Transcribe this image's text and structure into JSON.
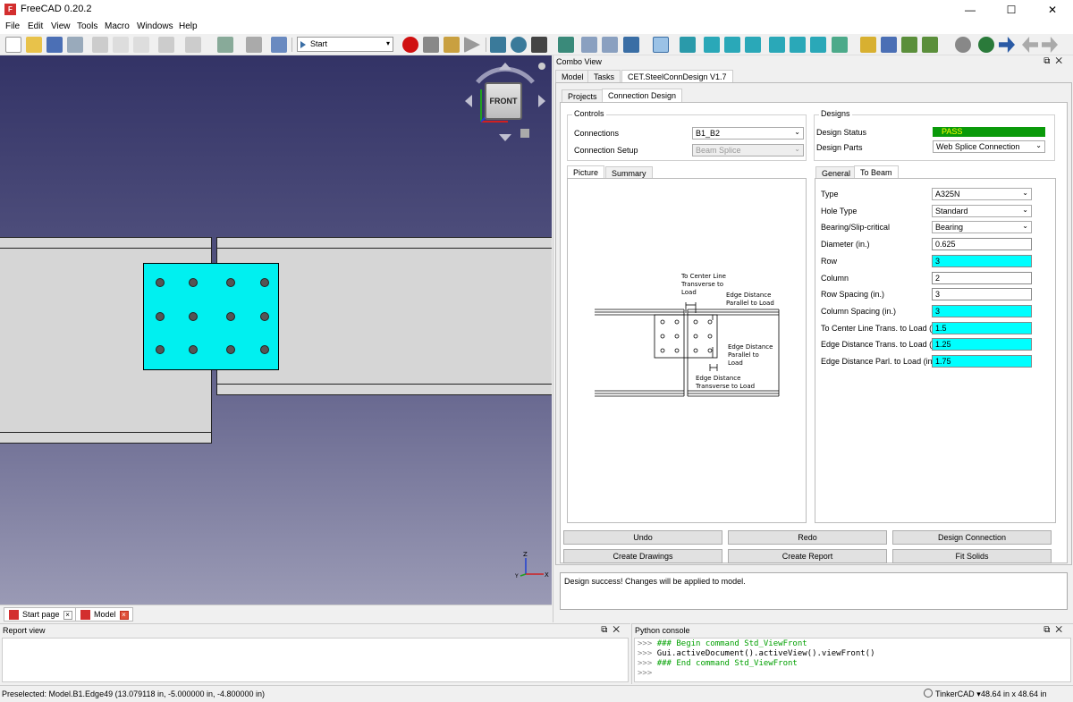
{
  "window": {
    "title": "FreeCAD 0.20.2",
    "minimize": "—",
    "maximize": "☐",
    "close": "✕"
  },
  "menu": [
    "File",
    "Edit",
    "View",
    "Tools",
    "Macro",
    "Windows",
    "Help"
  ],
  "toolbar": {
    "workbench": "Start"
  },
  "view3d": {
    "navcube_face": "FRONT",
    "axis_z": "Z",
    "axis_x": "X",
    "axis_y": "Y"
  },
  "view_tabs": [
    {
      "label": "Start page"
    },
    {
      "label": "Model"
    }
  ],
  "combo": {
    "title": "Combo View",
    "tabs": [
      "Model",
      "Tasks",
      "CET.SteelConnDesign V1.7"
    ],
    "subtabs": [
      "Projects",
      "Connection Design"
    ],
    "controls": {
      "title": "Controls",
      "connections_label": "Connections",
      "connections_value": "B1_B2",
      "setup_label": "Connection Setup",
      "setup_value": "Beam Splice"
    },
    "designs": {
      "title": "Designs",
      "status_label": "Design Status",
      "status_value": "PASS",
      "parts_label": "Design Parts",
      "parts_value": "Web Splice Connection"
    },
    "picture_tabs": [
      "Picture",
      "Summary"
    ],
    "diagram": {
      "l1": "To Center Line",
      "l2": "Transverse to",
      "l3": "Load",
      "e1": "Edge Distance",
      "e2": "Parallel to Load",
      "p1": "Edge Distance",
      "p2": "Parallel to",
      "p3": "Load",
      "t1": "Edge Distance",
      "t2": "Transverse to Load"
    },
    "param_tabs": [
      "General",
      "To Beam"
    ],
    "params": [
      {
        "label": "Type",
        "value": "A325N",
        "kind": "combo"
      },
      {
        "label": "Hole Type",
        "value": "Standard",
        "kind": "combo"
      },
      {
        "label": "Bearing/Slip-critical",
        "value": "Bearing",
        "kind": "combo"
      },
      {
        "label": "Diameter (in.)",
        "value": "0.625",
        "kind": "field"
      },
      {
        "label": "Row",
        "value": "3",
        "kind": "cyan"
      },
      {
        "label": "Column",
        "value": "2",
        "kind": "field"
      },
      {
        "label": "Row Spacing (in.)",
        "value": "3",
        "kind": "field"
      },
      {
        "label": "Column Spacing (in.)",
        "value": "3",
        "kind": "cyan"
      },
      {
        "label": "To Center Line Trans. to Load (in.)",
        "value": "1.5",
        "kind": "cyan"
      },
      {
        "label": "Edge Distance Trans. to Load (in.)",
        "value": "1.25",
        "kind": "cyan"
      },
      {
        "label": "Edge Distance Parl. to Load (in.)",
        "value": "1.75",
        "kind": "cyan"
      }
    ],
    "buttons": [
      "Undo",
      "Redo",
      "Design Connection",
      "Create Drawings",
      "Create Report",
      "Fit Solids"
    ],
    "message": "Design success! Changes will be applied to model."
  },
  "report": {
    "title": "Report view"
  },
  "python": {
    "title": "Python console",
    "lines": [
      {
        "prompt": ">>>",
        "text": "### Begin command Std_ViewFront",
        "color": "green"
      },
      {
        "prompt": ">>>",
        "text": "Gui.activeDocument().activeView().viewFront()",
        "color": "black"
      },
      {
        "prompt": ">>>",
        "text": "### End command Std_ViewFront",
        "color": "green"
      },
      {
        "prompt": ">>>",
        "text": "",
        "color": "black"
      }
    ]
  },
  "status": {
    "preselected": "Preselected: Model.B1.Edge49 (13.079118 in, -5.000000 in, -4.800000 in)",
    "nav_style": "TinkerCAD",
    "dimensions": "48.64 in x 48.64 in"
  },
  "colors": {
    "accent": "#00ffff",
    "pass": "#0a9a0a",
    "bg3d_top": "#333366",
    "bg3d_bottom": "#9a9ab5"
  }
}
